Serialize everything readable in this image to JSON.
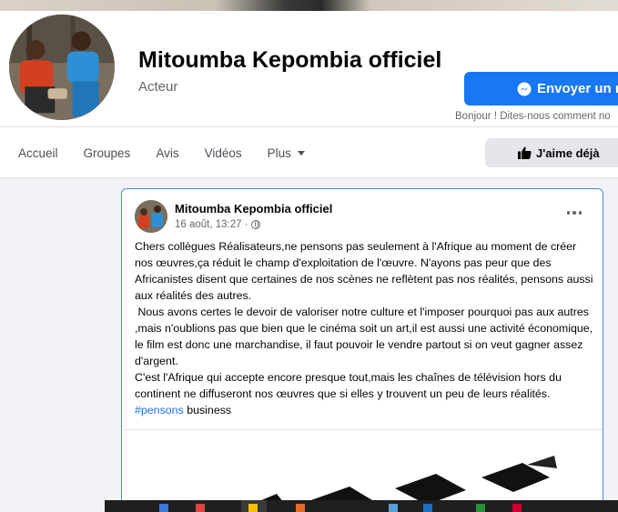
{
  "page": {
    "name": "Mitoumba Kepombia officiel",
    "category": "Acteur",
    "messenger_button": "Envoyer un m",
    "greeting": "Bonjour ! Dites-nous comment no"
  },
  "tabs": [
    {
      "label": "Accueil"
    },
    {
      "label": "Groupes"
    },
    {
      "label": "Avis"
    },
    {
      "label": "Vidéos"
    },
    {
      "label": "Plus"
    }
  ],
  "like_button": "J'aime déjà",
  "post": {
    "author": "Mitoumba Kepombia officiel",
    "time": "16 août, 13:27 ·",
    "paragraphs": [
      "Chers collègues Réalisateurs,ne pensons pas seulement à l'Afrique au moment de créer nos œuvres,ça réduit le champ d'exploitation de l'œuvre. N'ayons pas peur que des Africanistes disent que certaines de nos scènes ne reflètent pas nos réalités, pensons aussi aux réalités des autres.",
      " Nous avons certes le devoir de valoriser notre culture et l'imposer pourquoi pas aux autres ,mais n'oublions pas que bien que le cinéma soit un art,il est aussi une activité économique, le film est donc une marchandise, il faut pouvoir le vendre partout si on veut gagner assez d'argent.",
      "C'est l'Afrique qui accepte encore presque tout,mais les chaînes de télévision hors du continent ne diffuseront nos œuvres que si elles y trouvent un peu de leurs réalités."
    ],
    "hashtag": "#pensons",
    "tag_rest": " business"
  },
  "colors": {
    "accent": "#1877f2",
    "link": "#216fdb",
    "background": "#f0f2f5"
  }
}
